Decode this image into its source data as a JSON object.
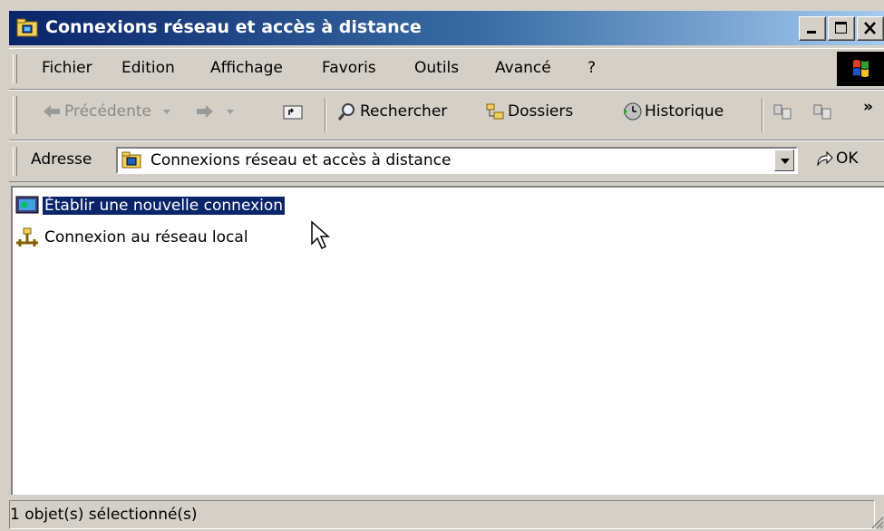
{
  "window": {
    "title": "Connexions réseau et accès à distance",
    "title_gradient_start": "#0a246a",
    "title_gradient_end": "#a6caf0",
    "icons": [
      "folder-network-icon"
    ]
  },
  "menubar": {
    "items": [
      "Fichier",
      "Edition",
      "Affichage",
      "Favoris",
      "Outils",
      "Avancé",
      "?"
    ]
  },
  "toolbar": {
    "back_label": "Précédente",
    "search_label": "Rechercher",
    "folders_label": "Dossiers",
    "history_label": "Historique",
    "overflow_label": "»"
  },
  "addressbar": {
    "label": "Adresse",
    "value": "Connexions réseau et accès à distance",
    "go_label": "OK"
  },
  "content": {
    "items": [
      {
        "label": "Établir une nouvelle connexion",
        "selected": true,
        "icon": "new-connection-icon"
      },
      {
        "label": "Connexion au réseau local",
        "selected": false,
        "icon": "lan-connection-icon"
      }
    ],
    "selection_color": "#0a246a"
  },
  "status": {
    "text": "1 objet(s) sélectionné(s)"
  }
}
